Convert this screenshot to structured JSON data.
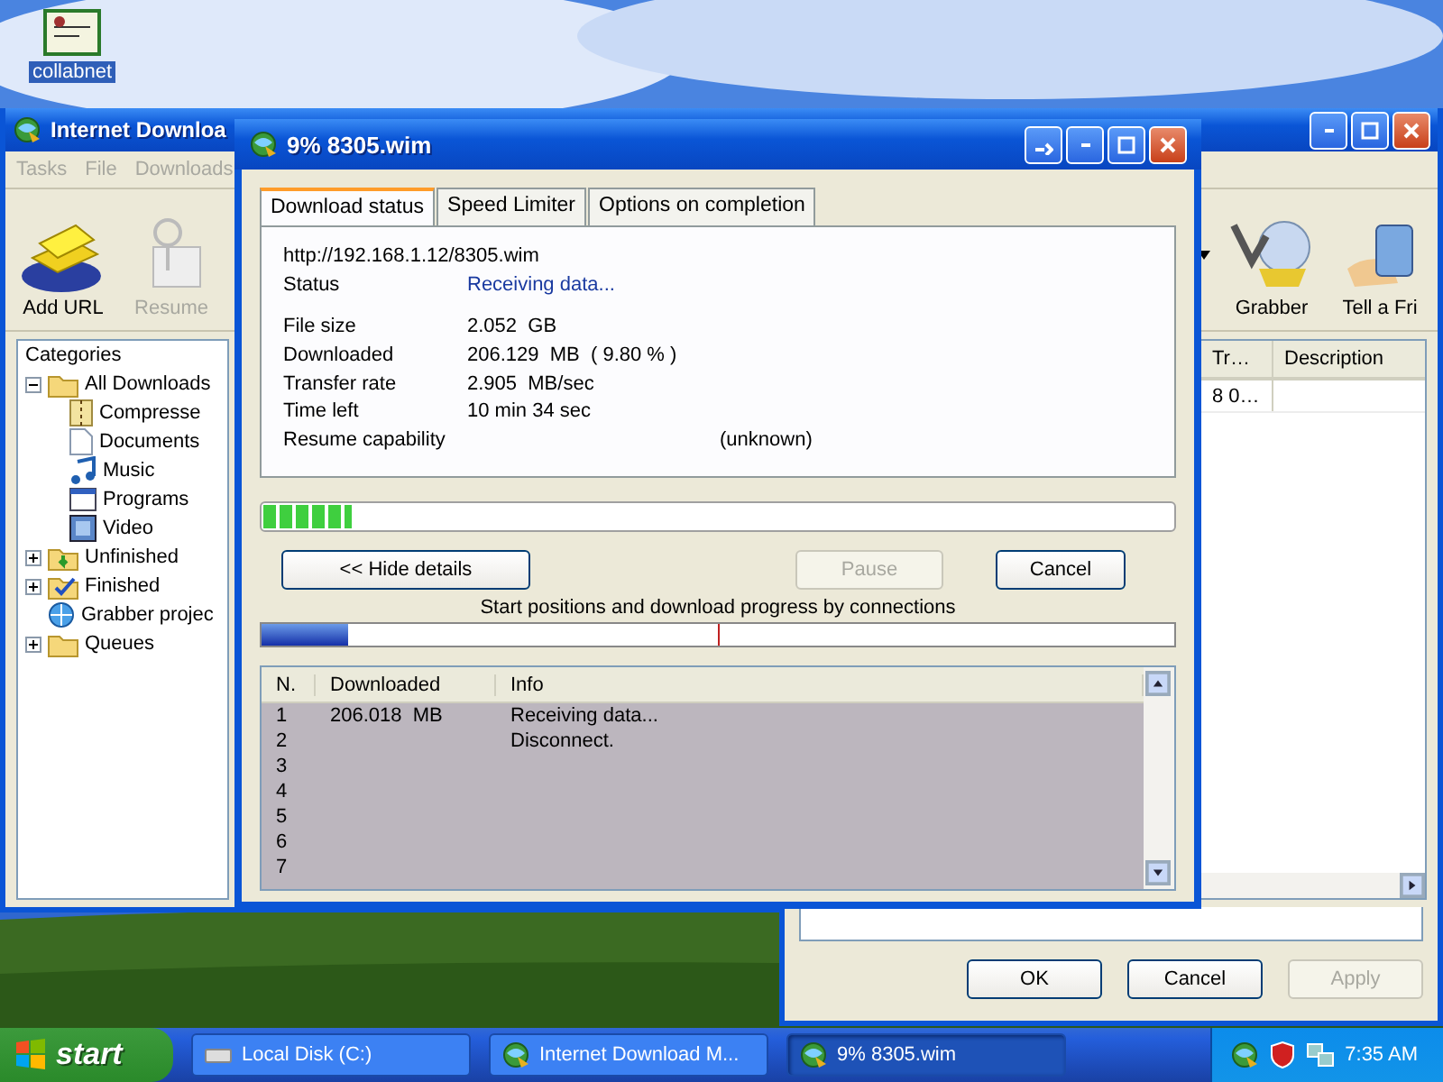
{
  "desktop": {
    "icons": [
      {
        "label": "collabnet"
      }
    ]
  },
  "main_window": {
    "title": "Internet Downloa",
    "menu": [
      "Tasks",
      "File",
      "Downloads"
    ],
    "toolbar": [
      {
        "label": "Add URL",
        "disabled": false,
        "kind": "add"
      },
      {
        "label": "Resume",
        "disabled": true,
        "kind": "resume"
      },
      {
        "label": "Grabber",
        "disabled": false,
        "kind": "grabber"
      },
      {
        "label": "Tell a Fri",
        "disabled": false,
        "kind": "tell"
      }
    ],
    "categories": {
      "title": "Categories",
      "tree": [
        {
          "label": "All Downloads",
          "kind": "folder-open",
          "expanded": true,
          "children": [
            {
              "label": "Compresse",
              "kind": "zip"
            },
            {
              "label": "Documents",
              "kind": "doc"
            },
            {
              "label": "Music",
              "kind": "music"
            },
            {
              "label": "Programs",
              "kind": "program"
            },
            {
              "label": "Video",
              "kind": "video"
            }
          ]
        },
        {
          "label": "Unfinished",
          "kind": "unfinished",
          "expanded": false
        },
        {
          "label": "Finished",
          "kind": "finished",
          "expanded": false
        },
        {
          "label": "Grabber projec",
          "kind": "globe"
        },
        {
          "label": "Queues",
          "kind": "folder",
          "expanded": false
        }
      ]
    },
    "columns": [
      "Tr…",
      "Description"
    ],
    "rows": [
      "8 0…"
    ]
  },
  "dialog": {
    "title": "9% 8305.wim",
    "tabs": [
      {
        "label": "Download status",
        "selected": true
      },
      {
        "label": "Speed Limiter",
        "selected": false
      },
      {
        "label": "Options on completion",
        "selected": false
      }
    ],
    "url": "http://192.168.1.12/8305.wim",
    "status": {
      "label": "Status",
      "value": "Receiving data..."
    },
    "fields": [
      {
        "label": "File size",
        "value": "2.052  GB"
      },
      {
        "label": "Downloaded",
        "value": "206.129  MB  ( 9.80 % )"
      },
      {
        "label": "Transfer rate",
        "value": "2.905  MB/sec"
      },
      {
        "label": "Time left",
        "value": "10 min 34 sec"
      },
      {
        "label": "Resume capability",
        "value": "(unknown)"
      }
    ],
    "progress": {
      "level": 0.098
    },
    "buttons": [
      {
        "label": "<< Hide details",
        "disabled": false
      },
      {
        "label": "Pause",
        "disabled": true
      },
      {
        "label": "Cancel",
        "disabled": false
      }
    ],
    "connections_label": "Start positions and download progress by connections",
    "connections_bar": {
      "level": 0.095
    },
    "table": {
      "columns": [
        "N.",
        "Downloaded",
        "Info"
      ],
      "rows": [
        {
          "n": "1",
          "downloaded": "206.018  MB",
          "info": "Receiving data..."
        },
        {
          "n": "2",
          "info": "Disconnect."
        },
        {
          "n": "3"
        },
        {
          "n": "4"
        },
        {
          "n": "5"
        },
        {
          "n": "6"
        },
        {
          "n": "7"
        }
      ]
    }
  },
  "back_window": {
    "buttons": [
      {
        "label": "OK",
        "disabled": false
      },
      {
        "label": "Cancel",
        "disabled": false
      },
      {
        "label": "Apply",
        "disabled": true
      }
    ]
  },
  "taskbar": {
    "start": "start",
    "tasks": [
      {
        "label": "Local Disk (C:)",
        "kind": "drive",
        "selected": false
      },
      {
        "label": "Internet Download M...",
        "kind": "idm",
        "selected": false
      },
      {
        "label": "9% 8305.wim",
        "kind": "idm",
        "selected": true
      }
    ],
    "clock": "7:35 AM"
  }
}
